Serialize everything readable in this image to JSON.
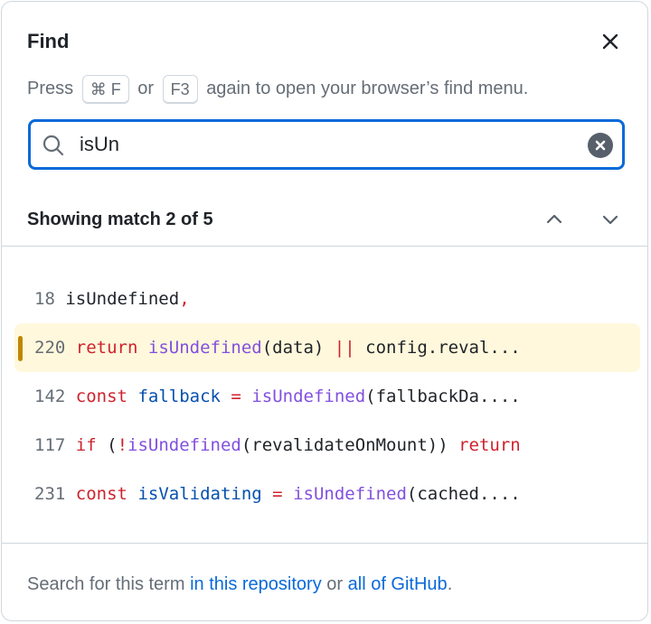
{
  "dialog": {
    "title": "Find",
    "close_icon": "close-icon"
  },
  "hint": {
    "prefix": "Press",
    "key1": "⌘ F",
    "or": "or",
    "key2": "F3",
    "suffix": "again to open your browser’s find menu."
  },
  "search": {
    "value": "isUn",
    "placeholder": "",
    "icon": "search-icon",
    "clear_icon": "clear-circle-icon"
  },
  "status": {
    "text": "Showing match 2 of 5",
    "current": 2,
    "total": 5,
    "prev_icon": "chevron-up-icon",
    "next_icon": "chevron-down-icon"
  },
  "results": [
    {
      "line": "18",
      "active": false,
      "tokens": [
        {
          "t": "isUndefined",
          "c": "plain"
        },
        {
          "t": ",",
          "c": "kw"
        }
      ]
    },
    {
      "line": "220",
      "active": true,
      "tokens": [
        {
          "t": "return",
          "c": "kw"
        },
        {
          "t": " ",
          "c": "plain"
        },
        {
          "t": "isUndefined",
          "c": "fn"
        },
        {
          "t": "(data) ",
          "c": "plain"
        },
        {
          "t": "||",
          "c": "kw"
        },
        {
          "t": " config.reval...",
          "c": "plain"
        }
      ]
    },
    {
      "line": "142",
      "active": false,
      "tokens": [
        {
          "t": "const",
          "c": "kw"
        },
        {
          "t": " ",
          "c": "plain"
        },
        {
          "t": "fallback",
          "c": "var"
        },
        {
          "t": " ",
          "c": "plain"
        },
        {
          "t": "=",
          "c": "kw"
        },
        {
          "t": " ",
          "c": "plain"
        },
        {
          "t": "isUndefined",
          "c": "fn"
        },
        {
          "t": "(fallbackDa....",
          "c": "plain"
        }
      ]
    },
    {
      "line": "117",
      "active": false,
      "tokens": [
        {
          "t": "if",
          "c": "kw"
        },
        {
          "t": " (",
          "c": "plain"
        },
        {
          "t": "!",
          "c": "kw"
        },
        {
          "t": "isUndefined",
          "c": "fn"
        },
        {
          "t": "(revalidateOnMount)) ",
          "c": "plain"
        },
        {
          "t": "return",
          "c": "kw"
        }
      ]
    },
    {
      "line": "231",
      "active": false,
      "tokens": [
        {
          "t": "const",
          "c": "kw"
        },
        {
          "t": " ",
          "c": "plain"
        },
        {
          "t": "isValidating",
          "c": "var"
        },
        {
          "t": " ",
          "c": "plain"
        },
        {
          "t": "=",
          "c": "kw"
        },
        {
          "t": " ",
          "c": "plain"
        },
        {
          "t": "isUndefined",
          "c": "fn"
        },
        {
          "t": "(cached....",
          "c": "plain"
        }
      ]
    }
  ],
  "footer": {
    "prefix": "Search for this term",
    "link1": "in this repository",
    "or": "or",
    "link2": "all of GitHub",
    "suffix": "."
  },
  "colors": {
    "accent": "#0969da",
    "keyword": "#cf222e",
    "function": "#8250df",
    "variable": "#0550ae",
    "active_bg": "#fff8dc",
    "active_marker": "#bf8700"
  }
}
